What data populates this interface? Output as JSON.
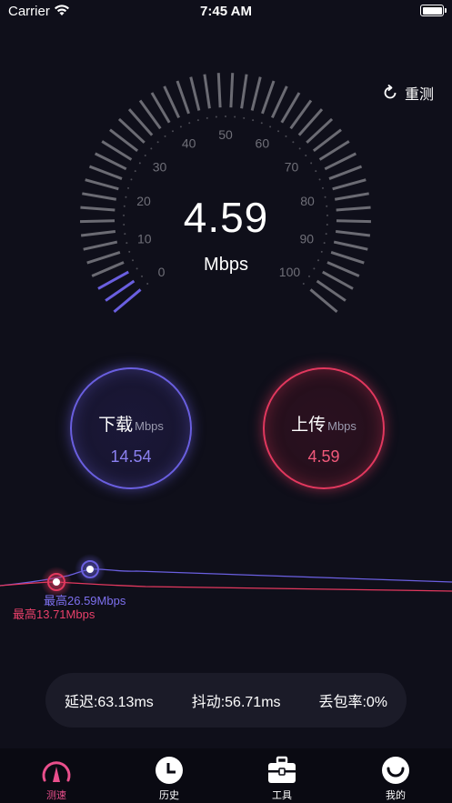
{
  "status": {
    "carrier": "Carrier",
    "time": "7:45 AM"
  },
  "header": {
    "retest_label": "重测"
  },
  "gauge": {
    "value": "4.59",
    "unit": "Mbps",
    "ticks": [
      "0",
      "10",
      "20",
      "30",
      "40",
      "50",
      "60",
      "70",
      "80",
      "90",
      "100"
    ],
    "progress_fraction": 0.046
  },
  "download": {
    "label": "下载",
    "unit": "Mbps",
    "value": "14.54"
  },
  "upload": {
    "label": "上传",
    "unit": "Mbps",
    "value": "4.59"
  },
  "chart": {
    "download_peak": "最高26.59Mbps",
    "upload_peak": "最高13.71Mbps"
  },
  "stats": {
    "latency": "延迟:63.13ms",
    "jitter": "抖动:56.71ms",
    "packet_loss": "丢包率:0%"
  },
  "tabs": [
    {
      "label": "测速",
      "icon": "speedometer-icon"
    },
    {
      "label": "历史",
      "icon": "clock-icon"
    },
    {
      "label": "工具",
      "icon": "toolbox-icon"
    },
    {
      "label": "我的",
      "icon": "profile-icon"
    }
  ],
  "colors": {
    "download": "#6a5fe0",
    "upload": "#e2385e",
    "active_tab": "#ea4f8c",
    "background": "#0f0f1a"
  }
}
